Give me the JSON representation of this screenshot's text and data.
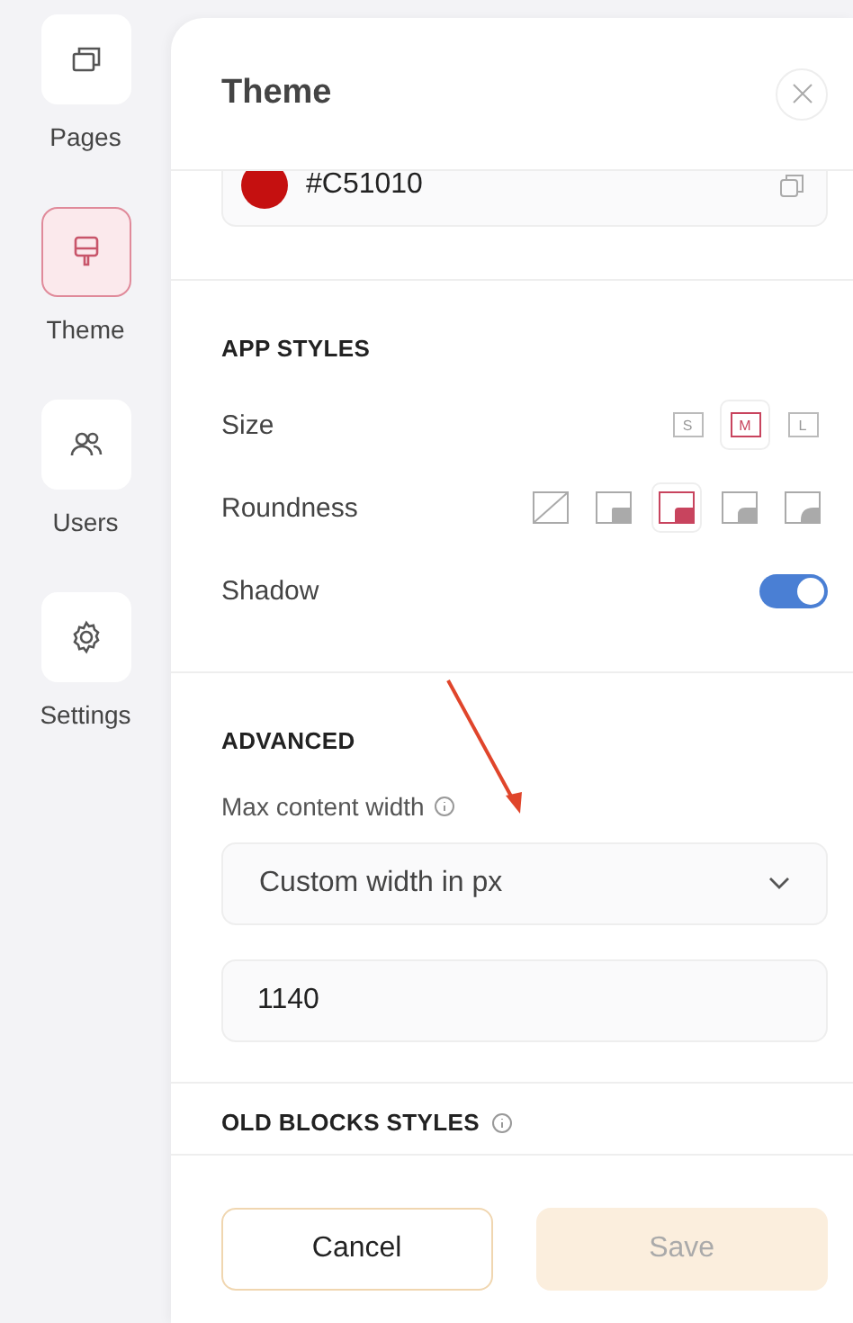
{
  "sidebar": {
    "items": [
      {
        "label": "Pages",
        "kind": "pages",
        "selected": false
      },
      {
        "label": "Theme",
        "kind": "theme",
        "selected": true
      },
      {
        "label": "Users",
        "kind": "users",
        "selected": false
      },
      {
        "label": "Settings",
        "kind": "settings",
        "selected": false
      }
    ]
  },
  "panel": {
    "title": "Theme",
    "color_field": {
      "value": "#C51010",
      "color": "#c51010"
    },
    "app_styles": {
      "heading": "APP STYLES",
      "size": {
        "label": "Size",
        "options": [
          {
            "label": "S",
            "selected": false
          },
          {
            "label": "M",
            "selected": true
          },
          {
            "label": "L",
            "selected": false
          }
        ]
      },
      "roundness": {
        "label": "Roundness",
        "options": [
          {
            "kind": "none",
            "selected": false
          },
          {
            "kind": "small",
            "selected": false
          },
          {
            "kind": "medium",
            "selected": true
          },
          {
            "kind": "large",
            "selected": false
          },
          {
            "kind": "full",
            "selected": false
          }
        ]
      },
      "shadow": {
        "label": "Shadow",
        "on": true
      }
    },
    "advanced": {
      "heading": "ADVANCED",
      "max_width_label": "Max content width",
      "select_value": "Custom width in px",
      "width_value": "1140"
    },
    "next_heading": "OLD BLOCKS STYLES",
    "buttons": [
      {
        "label": "Cancel",
        "kind": "secondary",
        "disabled": false
      },
      {
        "label": "Save",
        "kind": "primary",
        "disabled": true
      }
    ]
  }
}
